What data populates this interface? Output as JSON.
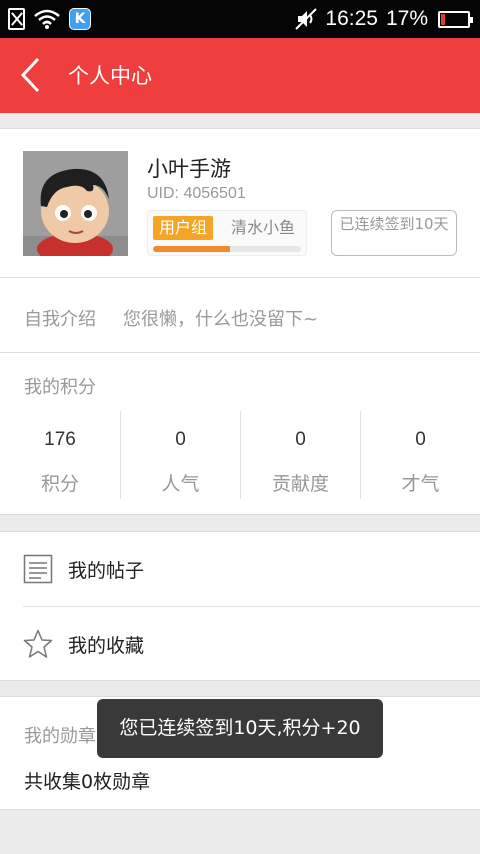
{
  "status_bar": {
    "time": "16:25",
    "battery_percent": "17%",
    "battery_level": 0.17,
    "icons": [
      "sim-missing-icon",
      "wifi-icon",
      "k-app-icon",
      "mute-icon",
      "battery-icon"
    ],
    "app_badge": "K"
  },
  "header": {
    "title": "个人中心",
    "back_icon": "chevron-left-icon"
  },
  "profile": {
    "username": "小叶手游",
    "uid": "UID: 4056501",
    "group_tag": "用户组",
    "group_name": "清水小鱼",
    "group_progress": 0.52,
    "checkin": "已连续签到10天"
  },
  "intro": {
    "label": "自我介绍",
    "text": "您很懒，什么也没留下~"
  },
  "points": {
    "title": "我的积分",
    "stats": [
      {
        "value": "176",
        "label": "积分"
      },
      {
        "value": "0",
        "label": "人气"
      },
      {
        "value": "0",
        "label": "贡献度"
      },
      {
        "value": "0",
        "label": "才气"
      }
    ]
  },
  "menu": {
    "items": [
      {
        "label": "我的帖子",
        "icon": "document-icon"
      },
      {
        "label": "我的收藏",
        "icon": "star-icon"
      }
    ]
  },
  "medals": {
    "title": "我的勋章",
    "count_text": "共收集0枚勋章"
  },
  "toast": {
    "message": "您已连续签到10天,积分+20"
  },
  "colors": {
    "accent": "#ee3e3e",
    "group_tag": "#f3a523",
    "progress": "#f08a2a"
  }
}
